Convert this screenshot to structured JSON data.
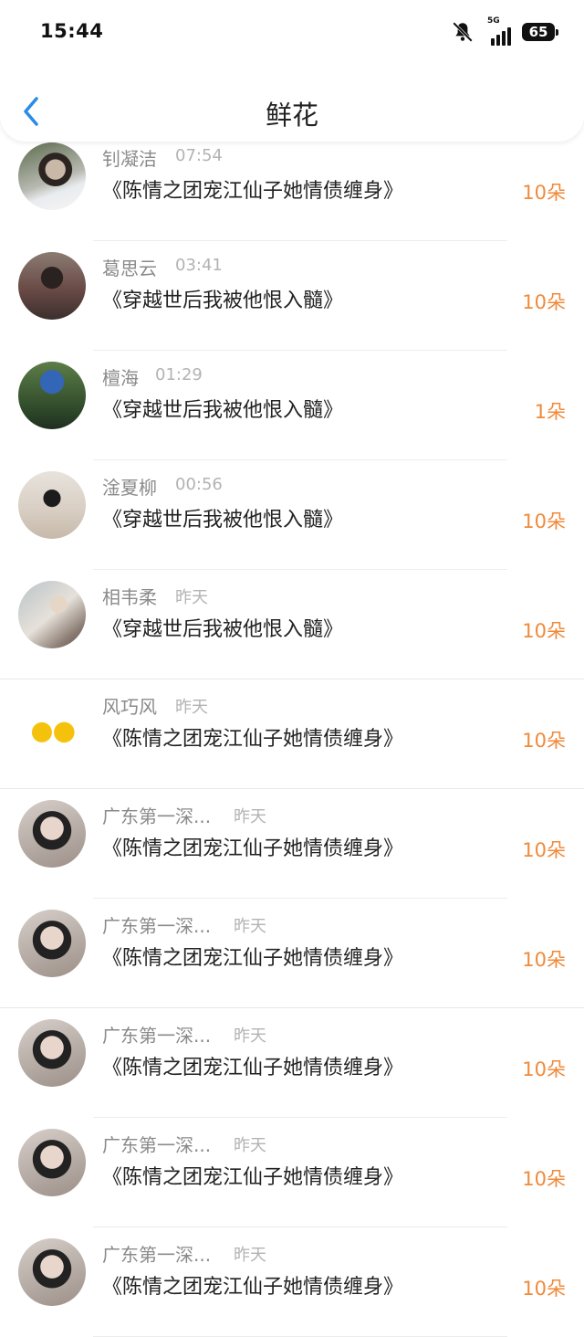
{
  "status_bar": {
    "time": "15:44",
    "network": "5G",
    "battery": "65",
    "icons": [
      "bell-muted-icon",
      "signal-icon",
      "battery-icon"
    ]
  },
  "nav": {
    "title": "鲜花",
    "back_icon": "chevron-left-icon",
    "accent_color": "#2a8ce6"
  },
  "colors": {
    "count": "#f08a3a",
    "name": "#8a8a8a",
    "time": "#b3b3b3"
  },
  "items": [
    {
      "name": "钊凝洁",
      "time": "07:54",
      "book": "《陈情之团宠江仙子她情债缠身》",
      "count": "10朵"
    },
    {
      "name": "葛思云",
      "time": "03:41",
      "book": "《穿越世后我被他恨入髓》",
      "count": "10朵"
    },
    {
      "name": "檀海",
      "time": "01:29",
      "book": "《穿越世后我被他恨入髓》",
      "count": "1朵"
    },
    {
      "name": "淦夏柳",
      "time": "00:56",
      "book": "《穿越世后我被他恨入髓》",
      "count": "10朵"
    },
    {
      "name": "相韦柔",
      "time": "昨天",
      "book": "《穿越世后我被他恨入髓》",
      "count": "10朵"
    },
    {
      "name": "风巧风",
      "time": "昨天",
      "book": "《陈情之团宠江仙子她情债缠身》",
      "count": "10朵"
    },
    {
      "name": "广东第一深...",
      "time": "昨天",
      "book": "《陈情之团宠江仙子她情债缠身》",
      "count": "10朵"
    },
    {
      "name": "广东第一深...",
      "time": "昨天",
      "book": "《陈情之团宠江仙子她情债缠身》",
      "count": "10朵"
    },
    {
      "name": "广东第一深...",
      "time": "昨天",
      "book": "《陈情之团宠江仙子她情债缠身》",
      "count": "10朵"
    },
    {
      "name": "广东第一深...",
      "time": "昨天",
      "book": "《陈情之团宠江仙子她情债缠身》",
      "count": "10朵"
    },
    {
      "name": "广东第一深...",
      "time": "昨天",
      "book": "《陈情之团宠江仙子她情债缠身》",
      "count": "10朵"
    }
  ]
}
